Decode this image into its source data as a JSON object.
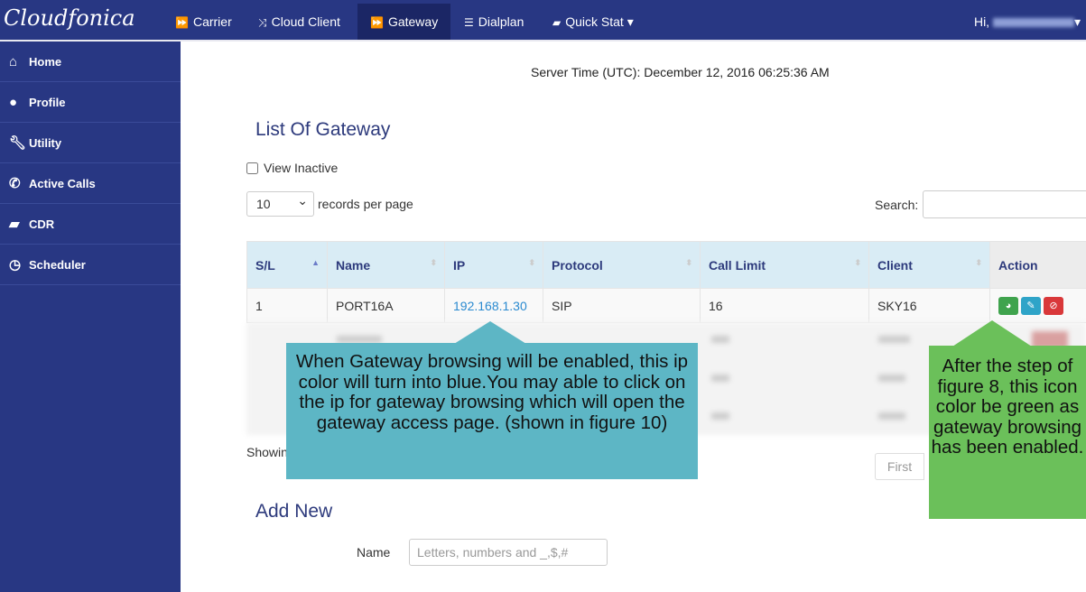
{
  "app": {
    "logo": "Cloudfonica",
    "greeting": "Hi,"
  },
  "nav": [
    {
      "label": "Carrier",
      "icon": "forward-icon"
    },
    {
      "label": "Cloud Client",
      "icon": "shuffle-icon"
    },
    {
      "label": "Gateway",
      "icon": "forward-icon",
      "active": true
    },
    {
      "label": "Dialplan",
      "icon": "list-icon"
    },
    {
      "label": "Quick Stat",
      "icon": "book-icon"
    }
  ],
  "sidebar": [
    {
      "label": "Home",
      "icon": "home-icon"
    },
    {
      "label": "Profile",
      "icon": "user-icon"
    },
    {
      "label": "Utility",
      "icon": "wrench-icon"
    },
    {
      "label": "Active Calls",
      "icon": "phone-icon"
    },
    {
      "label": "CDR",
      "icon": "book-icon"
    },
    {
      "label": "Scheduler",
      "icon": "clock-icon"
    }
  ],
  "server_time": "Server Time (UTC): December 12, 2016 06:25:36 AM",
  "list_title": "List Of Gateway",
  "view_inactive": "View Inactive",
  "records_per_page": {
    "value": "10",
    "label": "records per page"
  },
  "search_label": "Search:",
  "table": {
    "headers": [
      "S/L",
      "Name",
      "IP",
      "Protocol",
      "Call Limit",
      "Client",
      "Action"
    ],
    "rows": [
      {
        "sl": "1",
        "name": "PORT16A",
        "ip": "192.168.1.30",
        "protocol": "SIP",
        "call_limit": "16",
        "client": "SKY16"
      }
    ]
  },
  "showing": "Showin",
  "pagination": {
    "first": "First"
  },
  "add_new": {
    "title": "Add New",
    "name_label": "Name",
    "name_placeholder": "Letters, numbers and _,$,#"
  },
  "callouts": {
    "ip": "When Gateway browsing will be enabled, this ip color will turn into blue.You may able to click on the ip for gateway browsing which will open the gateway access page. (shown in figure 10)",
    "icon": "After the step of figure 8, this icon color be green as gateway browsing has been enabled."
  },
  "colors": {
    "nav": "#283783",
    "browse_button": "#3fa34d",
    "edit_button": "#2fa4c8",
    "delete_button": "#d9383a",
    "ip_link": "#2a8ad0"
  }
}
